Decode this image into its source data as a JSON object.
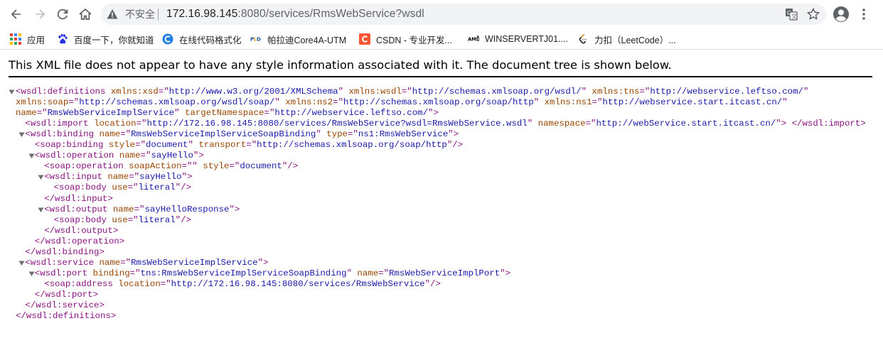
{
  "browser": {
    "url_security_label": "不安全",
    "url_host": "172.16.98.145",
    "url_path": ":8080/services/RmsWebService?wsdl",
    "accent_color": "#5f6368"
  },
  "bookmarks": [
    {
      "label": "应用",
      "icon": "apps-grid-icon"
    },
    {
      "label": "百度一下，你就知道",
      "icon": "baidu-paw-icon"
    },
    {
      "label": "在线代码格式化",
      "icon": "c-circle-icon"
    },
    {
      "label": "帕拉迪Core4A-UTM",
      "icon": "pld-logo-icon"
    },
    {
      "label": "CSDN - 专业开发...",
      "icon": "csdn-c-icon"
    },
    {
      "label": "WINSERVERTJ01....",
      "icon": "amd-logo-icon"
    },
    {
      "label": "力扣（LeetCode）...",
      "icon": "leetcode-icon"
    }
  ],
  "xml_notice": "This XML file does not appear to have any style information associated with it. The document tree is shown below.",
  "xml_lines": [
    {
      "fold": "expanded",
      "indent": 0,
      "parts": [
        {
          "c": "tag",
          "t": "<wsdl:definitions "
        },
        {
          "c": "attr-name",
          "t": "xmlns:xsd"
        },
        {
          "c": "tag",
          "t": "=\""
        },
        {
          "c": "attr-val",
          "t": "http://www.w3.org/2001/XMLSchema"
        },
        {
          "c": "tag",
          "t": "\" "
        },
        {
          "c": "attr-name",
          "t": "xmlns:wsdl"
        },
        {
          "c": "tag",
          "t": "=\""
        },
        {
          "c": "attr-val",
          "t": "http://schemas.xmlsoap.org/wsdl/"
        },
        {
          "c": "tag",
          "t": "\" "
        },
        {
          "c": "attr-name",
          "t": "xmlns:tns"
        },
        {
          "c": "tag",
          "t": "=\""
        },
        {
          "c": "attr-val",
          "t": "http://webservice.leftso.com/"
        },
        {
          "c": "tag",
          "t": "\""
        }
      ]
    },
    {
      "fold": "none",
      "indent": 1,
      "parts": [
        {
          "c": "attr-name",
          "t": "xmlns:soap"
        },
        {
          "c": "tag",
          "t": "=\""
        },
        {
          "c": "attr-val",
          "t": "http://schemas.xmlsoap.org/wsdl/soap/"
        },
        {
          "c": "tag",
          "t": "\" "
        },
        {
          "c": "attr-name",
          "t": "xmlns:ns2"
        },
        {
          "c": "tag",
          "t": "=\""
        },
        {
          "c": "attr-val",
          "t": "http://schemas.xmlsoap.org/soap/http"
        },
        {
          "c": "tag",
          "t": "\" "
        },
        {
          "c": "attr-name",
          "t": "xmlns:ns1"
        },
        {
          "c": "tag",
          "t": "=\""
        },
        {
          "c": "attr-val",
          "t": "http://webservice.start.itcast.cn/"
        },
        {
          "c": "tag",
          "t": "\""
        }
      ]
    },
    {
      "fold": "none",
      "indent": 1,
      "parts": [
        {
          "c": "attr-name",
          "t": "name"
        },
        {
          "c": "tag",
          "t": "=\""
        },
        {
          "c": "attr-val",
          "t": "RmsWebServiceImplService"
        },
        {
          "c": "tag",
          "t": "\" "
        },
        {
          "c": "attr-name",
          "t": "targetNamespace"
        },
        {
          "c": "tag",
          "t": "=\""
        },
        {
          "c": "attr-val",
          "t": "http://webservice.leftso.com/"
        },
        {
          "c": "tag",
          "t": "\">"
        }
      ]
    },
    {
      "fold": "none",
      "indent": 2,
      "parts": [
        {
          "c": "tag",
          "t": "<wsdl:import "
        },
        {
          "c": "attr-name",
          "t": "location"
        },
        {
          "c": "tag",
          "t": "=\""
        },
        {
          "c": "attr-val",
          "t": "http://172.16.98.145:8080/services/RmsWebService?wsdl=RmsWebService.wsdl"
        },
        {
          "c": "tag",
          "t": "\" "
        },
        {
          "c": "attr-name",
          "t": "namespace"
        },
        {
          "c": "tag",
          "t": "=\""
        },
        {
          "c": "attr-val",
          "t": "http://webService.start.itcast.cn/"
        },
        {
          "c": "tag",
          "t": "\">"
        },
        {
          "c": "txt",
          "t": " "
        },
        {
          "c": "tag",
          "t": "</wsdl:import>"
        }
      ]
    },
    {
      "fold": "expanded",
      "indent": 2,
      "parts": [
        {
          "c": "tag",
          "t": "<wsdl:binding "
        },
        {
          "c": "attr-name",
          "t": "name"
        },
        {
          "c": "tag",
          "t": "=\""
        },
        {
          "c": "attr-val",
          "t": "RmsWebServiceImplServiceSoapBinding"
        },
        {
          "c": "tag",
          "t": "\" "
        },
        {
          "c": "attr-name",
          "t": "type"
        },
        {
          "c": "tag",
          "t": "=\""
        },
        {
          "c": "attr-val",
          "t": "ns1:RmsWebService"
        },
        {
          "c": "tag",
          "t": "\">"
        }
      ]
    },
    {
      "fold": "none",
      "indent": 3,
      "parts": [
        {
          "c": "tag",
          "t": "<soap:binding "
        },
        {
          "c": "attr-name",
          "t": "style"
        },
        {
          "c": "tag",
          "t": "=\""
        },
        {
          "c": "attr-val",
          "t": "document"
        },
        {
          "c": "tag",
          "t": "\" "
        },
        {
          "c": "attr-name",
          "t": "transport"
        },
        {
          "c": "tag",
          "t": "=\""
        },
        {
          "c": "attr-val",
          "t": "http://schemas.xmlsoap.org/soap/http"
        },
        {
          "c": "tag",
          "t": "\"/>"
        }
      ]
    },
    {
      "fold": "expanded",
      "indent": 3,
      "parts": [
        {
          "c": "tag",
          "t": "<wsdl:operation "
        },
        {
          "c": "attr-name",
          "t": "name"
        },
        {
          "c": "tag",
          "t": "=\""
        },
        {
          "c": "attr-val",
          "t": "sayHello"
        },
        {
          "c": "tag",
          "t": "\">"
        }
      ]
    },
    {
      "fold": "none",
      "indent": 4,
      "parts": [
        {
          "c": "tag",
          "t": "<soap:operation "
        },
        {
          "c": "attr-name",
          "t": "soapAction"
        },
        {
          "c": "tag",
          "t": "=\""
        },
        {
          "c": "attr-val",
          "t": ""
        },
        {
          "c": "tag",
          "t": "\" "
        },
        {
          "c": "attr-name",
          "t": "style"
        },
        {
          "c": "tag",
          "t": "=\""
        },
        {
          "c": "attr-val",
          "t": "document"
        },
        {
          "c": "tag",
          "t": "\"/>"
        }
      ]
    },
    {
      "fold": "expanded",
      "indent": 4,
      "parts": [
        {
          "c": "tag",
          "t": "<wsdl:input "
        },
        {
          "c": "attr-name",
          "t": "name"
        },
        {
          "c": "tag",
          "t": "=\""
        },
        {
          "c": "attr-val",
          "t": "sayHello"
        },
        {
          "c": "tag",
          "t": "\">"
        }
      ]
    },
    {
      "fold": "none",
      "indent": 5,
      "parts": [
        {
          "c": "tag",
          "t": "<soap:body "
        },
        {
          "c": "attr-name",
          "t": "use"
        },
        {
          "c": "tag",
          "t": "=\""
        },
        {
          "c": "attr-val",
          "t": "literal"
        },
        {
          "c": "tag",
          "t": "\"/>"
        }
      ]
    },
    {
      "fold": "none",
      "indent": 4,
      "parts": [
        {
          "c": "tag",
          "t": "</wsdl:input>"
        }
      ]
    },
    {
      "fold": "expanded",
      "indent": 4,
      "parts": [
        {
          "c": "tag",
          "t": "<wsdl:output "
        },
        {
          "c": "attr-name",
          "t": "name"
        },
        {
          "c": "tag",
          "t": "=\""
        },
        {
          "c": "attr-val",
          "t": "sayHelloResponse"
        },
        {
          "c": "tag",
          "t": "\">"
        }
      ]
    },
    {
      "fold": "none",
      "indent": 5,
      "parts": [
        {
          "c": "tag",
          "t": "<soap:body "
        },
        {
          "c": "attr-name",
          "t": "use"
        },
        {
          "c": "tag",
          "t": "=\""
        },
        {
          "c": "attr-val",
          "t": "literal"
        },
        {
          "c": "tag",
          "t": "\"/>"
        }
      ]
    },
    {
      "fold": "none",
      "indent": 4,
      "parts": [
        {
          "c": "tag",
          "t": "</wsdl:output>"
        }
      ]
    },
    {
      "fold": "none",
      "indent": 3,
      "parts": [
        {
          "c": "tag",
          "t": "</wsdl:operation>"
        }
      ]
    },
    {
      "fold": "none",
      "indent": 2,
      "parts": [
        {
          "c": "tag",
          "t": "</wsdl:binding>"
        }
      ]
    },
    {
      "fold": "expanded",
      "indent": 2,
      "parts": [
        {
          "c": "tag",
          "t": "<wsdl:service "
        },
        {
          "c": "attr-name",
          "t": "name"
        },
        {
          "c": "tag",
          "t": "=\""
        },
        {
          "c": "attr-val",
          "t": "RmsWebServiceImplService"
        },
        {
          "c": "tag",
          "t": "\">"
        }
      ]
    },
    {
      "fold": "expanded",
      "indent": 3,
      "parts": [
        {
          "c": "tag",
          "t": "<wsdl:port "
        },
        {
          "c": "attr-name",
          "t": "binding"
        },
        {
          "c": "tag",
          "t": "=\""
        },
        {
          "c": "attr-val",
          "t": "tns:RmsWebServiceImplServiceSoapBinding"
        },
        {
          "c": "tag",
          "t": "\" "
        },
        {
          "c": "attr-name",
          "t": "name"
        },
        {
          "c": "tag",
          "t": "=\""
        },
        {
          "c": "attr-val",
          "t": "RmsWebServiceImplPort"
        },
        {
          "c": "tag",
          "t": "\">"
        }
      ]
    },
    {
      "fold": "none",
      "indent": 4,
      "parts": [
        {
          "c": "tag",
          "t": "<soap:address "
        },
        {
          "c": "attr-name",
          "t": "location"
        },
        {
          "c": "tag",
          "t": "=\""
        },
        {
          "c": "attr-val",
          "t": "http://172.16.98.145:8080/services/RmsWebService"
        },
        {
          "c": "tag",
          "t": "\"/>"
        }
      ]
    },
    {
      "fold": "none",
      "indent": 3,
      "parts": [
        {
          "c": "tag",
          "t": "</wsdl:port>"
        }
      ]
    },
    {
      "fold": "none",
      "indent": 2,
      "parts": [
        {
          "c": "tag",
          "t": "</wsdl:service>"
        }
      ]
    },
    {
      "fold": "none",
      "indent": 1,
      "parts": [
        {
          "c": "tag",
          "t": "</wsdl:definitions>"
        }
      ]
    }
  ]
}
